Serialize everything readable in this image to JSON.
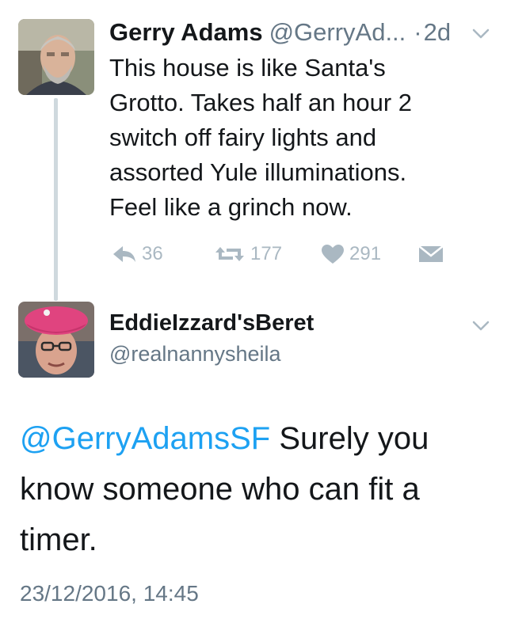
{
  "tweet1": {
    "display_name": "Gerry Adams",
    "handle": "@GerryAd...",
    "separator": "·",
    "time_ago": "2d",
    "text_lines": [
      "This house is like Santa's",
      "Grotto. Takes half an hour 2",
      "switch off fairy lights and",
      "assorted Yule illuminations.",
      "Feel like a grinch now."
    ],
    "actions": {
      "reply_count": "36",
      "retweet_count": "177",
      "like_count": "291"
    }
  },
  "tweet2": {
    "display_name": "EddieIzzard'sBeret",
    "handle": "@realnannysheila",
    "mention": "@GerryAdamsSF",
    "text_line1_rest": " Surely you",
    "text_line2": "know someone who can fit a",
    "text_line3": "timer.",
    "timestamp": "23/12/2016, 14:45"
  },
  "icons": {
    "reply": "reply-icon",
    "retweet": "retweet-icon",
    "like": "heart-icon",
    "dm": "envelope-icon",
    "caret": "chevron-down-icon"
  },
  "colors": {
    "text": "#14171a",
    "secondary": "#657786",
    "action_gray": "#aab8c2",
    "link_blue": "#1da1f2",
    "thread_line": "#cfd9de"
  }
}
